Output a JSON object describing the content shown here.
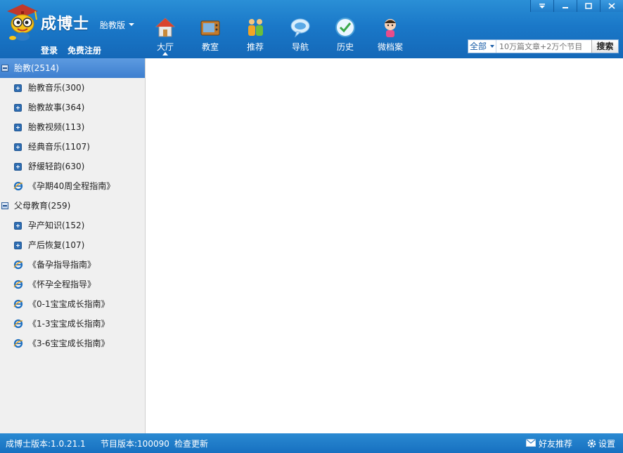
{
  "header": {
    "brand": "成博士",
    "edition": "胎教版",
    "login": "登录",
    "register": "免费注册",
    "nav": [
      {
        "label": "大厅",
        "icon": "house-icon",
        "active": true
      },
      {
        "label": "教室",
        "icon": "tv-icon"
      },
      {
        "label": "推荐",
        "icon": "people-icon"
      },
      {
        "label": "导航",
        "icon": "chat-bubble-icon"
      },
      {
        "label": "历史",
        "icon": "history-icon"
      },
      {
        "label": "微档案",
        "icon": "baby-icon"
      }
    ],
    "search": {
      "scope": "全部",
      "placeholder": "10万篇文章+2万个节目",
      "button": "搜索"
    },
    "window_controls": [
      "menu-icon",
      "minimize-icon",
      "maximize-icon",
      "close-icon"
    ]
  },
  "sidebar": {
    "items": [
      {
        "type": "category",
        "label": "胎教(2514)",
        "selected": true
      },
      {
        "type": "folder",
        "label": "胎教音乐(300)"
      },
      {
        "type": "folder",
        "label": "胎教故事(364)"
      },
      {
        "type": "folder",
        "label": "胎教视频(113)"
      },
      {
        "type": "folder",
        "label": "经典音乐(1107)"
      },
      {
        "type": "folder",
        "label": "舒缓轻韵(630)"
      },
      {
        "type": "link",
        "label": "《孕期40周全程指南》"
      },
      {
        "type": "category",
        "label": "父母教育(259)"
      },
      {
        "type": "folder",
        "label": "孕产知识(152)"
      },
      {
        "type": "folder",
        "label": "产后恢复(107)"
      },
      {
        "type": "link",
        "label": "《备孕指导指南》"
      },
      {
        "type": "link",
        "label": "《怀孕全程指导》"
      },
      {
        "type": "link",
        "label": "《0-1宝宝成长指南》"
      },
      {
        "type": "link",
        "label": "《1-3宝宝成长指南》"
      },
      {
        "type": "link",
        "label": "《3-6宝宝成长指南》"
      }
    ]
  },
  "status": {
    "app_version": "成博士版本:1.0.21.1",
    "program_version": "节目版本:100090",
    "check_update": "检查更新",
    "recommend": "好友推荐",
    "settings": "设置"
  },
  "colors": {
    "header_blue": "#1a78c8",
    "selected_blue": "#4a8ad6",
    "sidebar_bg": "#f0f0f0"
  }
}
